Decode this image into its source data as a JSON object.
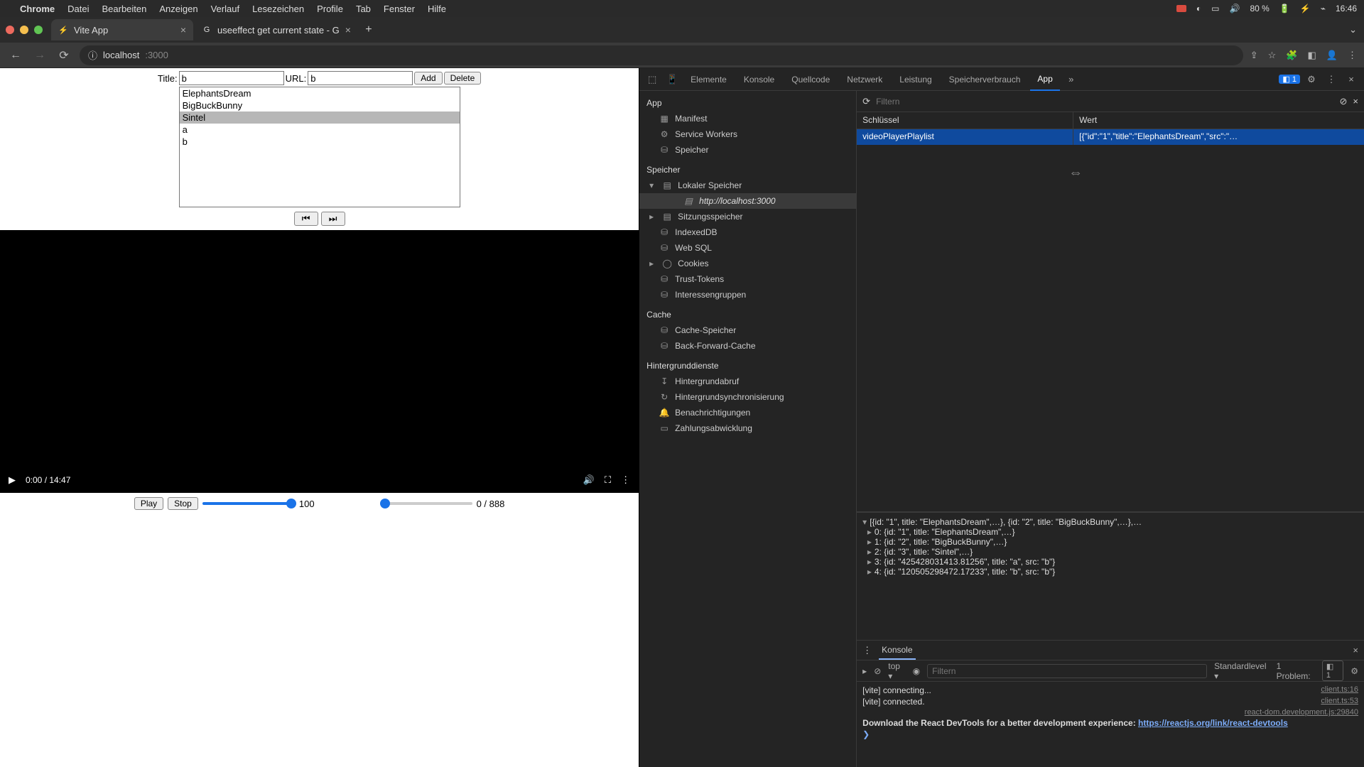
{
  "menubar": {
    "app": "Chrome",
    "items": [
      "Datei",
      "Bearbeiten",
      "Anzeigen",
      "Verlauf",
      "Lesezeichen",
      "Profile",
      "Tab",
      "Fenster",
      "Hilfe"
    ],
    "battery": "80 %",
    "clock": "16:46"
  },
  "tabs": {
    "t1": "Vite App",
    "t2": "useeffect get current state - G"
  },
  "address": {
    "host": "localhost",
    "port": ":3000"
  },
  "form": {
    "title_label": "Title:",
    "title_value": "b",
    "url_label": "URL:",
    "url_value": "b",
    "add": "Add",
    "delete": "Delete"
  },
  "playlist": {
    "items": [
      "ElephantsDream",
      "BigBuckBunny",
      "Sintel",
      "a",
      "b"
    ],
    "selected_index": 2,
    "prev": "⏮",
    "next": "⏭"
  },
  "video": {
    "time": "0:00 / 14:47"
  },
  "controls": {
    "play": "Play",
    "stop": "Stop",
    "vol": "100",
    "pos": "0 / 888"
  },
  "devtools": {
    "tabs": [
      "Elemente",
      "Konsole",
      "Quellcode",
      "Netzwerk",
      "Leistung",
      "Speicherverbrauch",
      "App"
    ],
    "active_tab": "App",
    "badge": "1",
    "filter_placeholder": "Filtern",
    "col_key": "Schlüssel",
    "col_val": "Wert",
    "storage_key": "videoPlayerPlaylist",
    "storage_val": "[{\"id\":\"1\",\"title\":\"ElephantsDream\",\"src\":\"…",
    "sidebar": {
      "app": "App",
      "manifest": "Manifest",
      "sw": "Service Workers",
      "speicher": "Speicher",
      "sect_speicher": "Speicher",
      "local": "Lokaler Speicher",
      "origin": "http://localhost:3000",
      "session": "Sitzungsspeicher",
      "idb": "IndexedDB",
      "websql": "Web SQL",
      "cookies": "Cookies",
      "trust": "Trust-Tokens",
      "interest": "Interessengruppen",
      "sect_cache": "Cache",
      "cachestore": "Cache-Speicher",
      "bfcache": "Back-Forward-Cache",
      "sect_bg": "Hintergrunddienste",
      "bgfetch": "Hintergrundabruf",
      "bgsync": "Hintergrundsynchronisierung",
      "notif": "Benachrichtigungen",
      "payment": "Zahlungsabwicklung"
    },
    "preview": {
      "l0": "[{id: \"1\", title: \"ElephantsDream\",…}, {id: \"2\", title: \"BigBuckBunny\",…},…",
      "l1": "0: {id: \"1\", title: \"ElephantsDream\",…}",
      "l2": "1: {id: \"2\", title: \"BigBuckBunny\",…}",
      "l3": "2: {id: \"3\", title: \"Sintel\",…}",
      "l4": "3: {id: \"425428031413.81256\", title: \"a\", src: \"b\"}",
      "l5": "4: {id: \"120505298472.17233\", title: \"b\", src: \"b\"}"
    },
    "console": {
      "title": "Konsole",
      "top": "top",
      "filter_placeholder": "Filtern",
      "level": "Standardlevel",
      "problems": "1 Problem:",
      "problems_count": "1",
      "lines": [
        {
          "txt": "[vite] connecting...",
          "src": "client.ts:16"
        },
        {
          "txt": "[vite] connected.",
          "src": "client.ts:53"
        },
        {
          "txt": "",
          "src": "react-dom.development.js:29840"
        },
        {
          "txt": "Download the React DevTools for a better development experience: ",
          "link": "https://reactjs.org/link/react-devtools",
          "bold": true
        }
      ]
    }
  }
}
